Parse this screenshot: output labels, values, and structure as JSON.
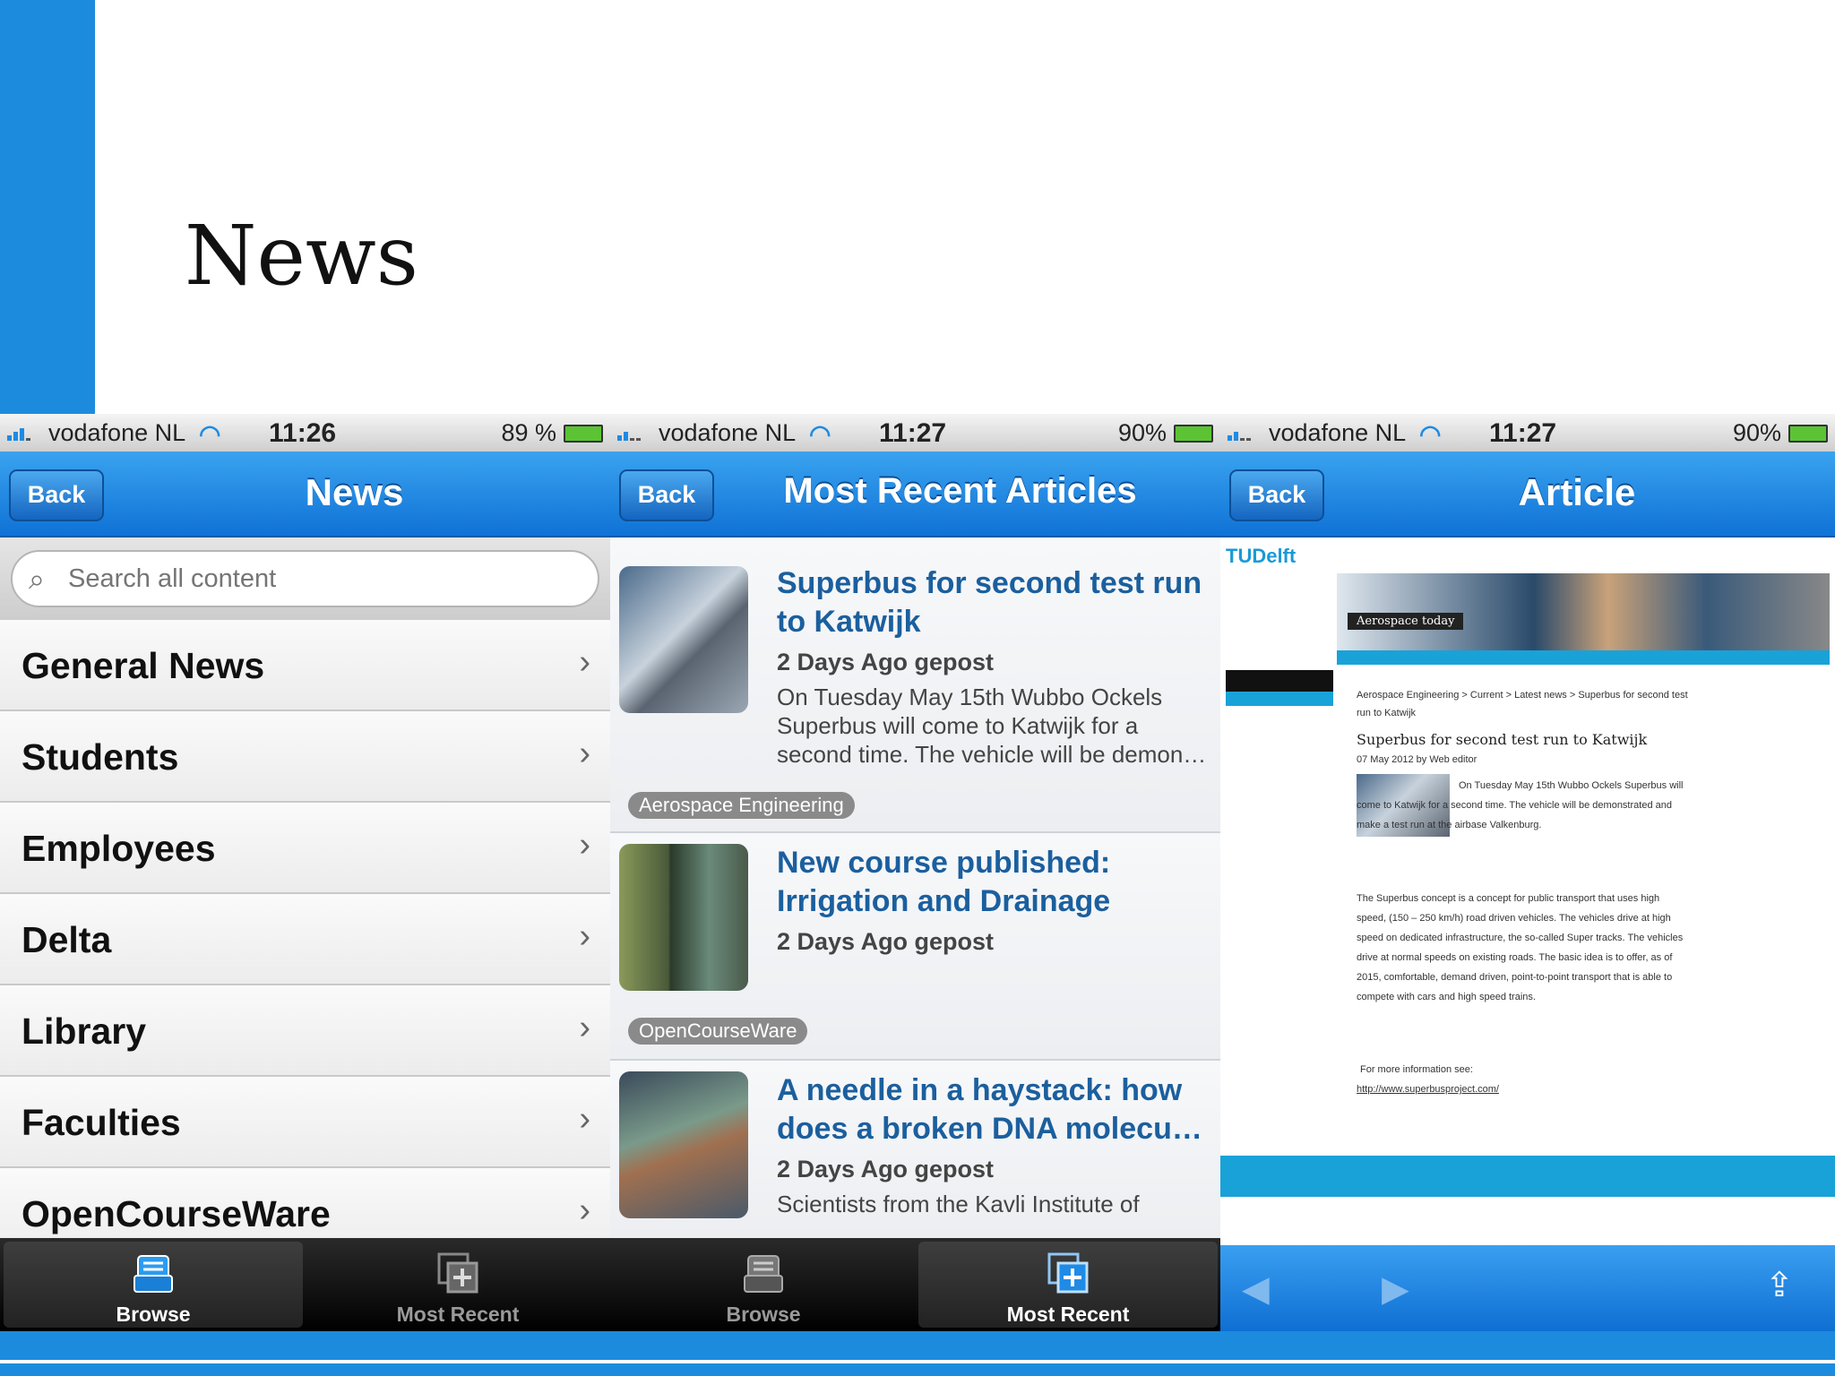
{
  "slide": {
    "title": "News"
  },
  "status_bars": [
    {
      "carrier": "vodafone NL",
      "time": "11:26",
      "battery": "89 %"
    },
    {
      "carrier": "vodafone NL",
      "time": "11:27",
      "battery": "90%"
    },
    {
      "carrier": "vodafone NL",
      "time": "11:27",
      "battery": "90%"
    }
  ],
  "screen1": {
    "back": "Back",
    "title": "News",
    "search_placeholder": "Search all content",
    "items": [
      "General News",
      "Students",
      "Employees",
      "Delta",
      "Library",
      "Faculties",
      "OpenCourseWare"
    ]
  },
  "screen2": {
    "back": "Back",
    "title": "Most Recent Articles",
    "articles": [
      {
        "title": "Superbus for second test run to Katwijk",
        "date": "2 Days Ago gepost",
        "summary": "On Tuesday May 15th Wubbo Ockels Superbus will come to Katwijk for a second time. The vehicle will be demon…",
        "tag": "Aerospace Engineering"
      },
      {
        "title": "New course published: Irrigation and Drainage",
        "date": "2 Days Ago gepost",
        "summary": "",
        "tag": "OpenCourseWare"
      },
      {
        "title": "A needle in a haystack: how does a broken DNA molecu…",
        "date": "2 Days Ago gepost",
        "summary": "Scientists from the Kavli Institute of",
        "tag": ""
      }
    ]
  },
  "screen3": {
    "back": "Back",
    "title": "Article",
    "web": {
      "logo": "TUDelft",
      "banner": "Aerospace today",
      "breadcrumb": "Aerospace Engineering > Current > Latest news > Superbus for second test run to Katwijk",
      "heading": "Superbus for second test run to Katwijk",
      "byline": "07 May 2012 by Web editor",
      "p1": "On Tuesday May 15th Wubbo Ockels Superbus will come to Katwijk for a second time. The vehicle will be demonstrated and make a test run at the airbase Valkenburg.",
      "p2": "The Superbus concept is a concept for public transport that uses high speed, (150 – 250 km/h) road driven vehicles. The vehicles drive at high speed on dedicated infrastructure, the so-called Super tracks. The vehicles drive at normal speeds on existing roads. The basic idea is to offer, as of 2015, comfortable, demand driven, point-to-point transport that is able to compete with cars and high speed trains.",
      "p3": "For more information see:",
      "link": "http://www.superbusproject.com/"
    }
  },
  "tabs": {
    "browse": "Browse",
    "recent": "Most Recent"
  },
  "colors": {
    "accent": "#1c8bde",
    "nav_blue": "#1677d9",
    "title_blue": "#1b5f9e"
  }
}
